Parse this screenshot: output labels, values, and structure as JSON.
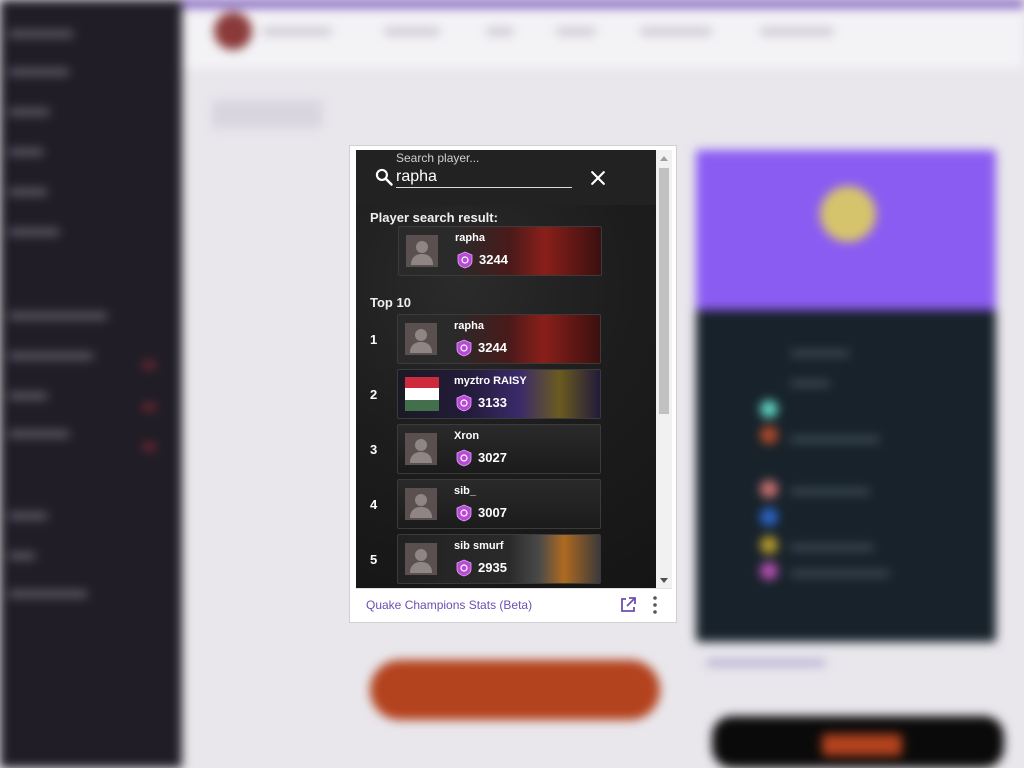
{
  "search": {
    "placeholder": "Search player...",
    "value": "rapha"
  },
  "result_section": {
    "title": "Player search result:",
    "players": [
      {
        "name": "rapha",
        "elo": "3244",
        "avatar": "default-avatar-icon",
        "banner": "red-champion"
      }
    ]
  },
  "top_section": {
    "title": "Top 10",
    "players": [
      {
        "rank": "1",
        "name": "rapha",
        "elo": "3244",
        "avatar": "default-avatar-icon",
        "banner": "red-champion"
      },
      {
        "rank": "2",
        "name": "myztro RAISY",
        "elo": "3133",
        "avatar": "hungary-flag-icon",
        "banner": "purple-creature"
      },
      {
        "rank": "3",
        "name": "Xron",
        "elo": "3027",
        "avatar": "default-avatar-icon",
        "banner": "plain"
      },
      {
        "rank": "4",
        "name": "sib_",
        "elo": "3007",
        "avatar": "default-avatar-icon",
        "banner": "plain"
      },
      {
        "rank": "5",
        "name": "sib smurf",
        "elo": "2935",
        "avatar": "default-avatar-icon",
        "banner": "orange-hex"
      }
    ]
  },
  "footer": {
    "title": "Quake Champions Stats (Beta)",
    "popout_icon": "popout-icon",
    "menu_icon": "more-vertical-icon"
  },
  "colors": {
    "accent": "#6c4fb2",
    "panel_bg": "#1d1d1d",
    "rank_badge": "#b84bd6"
  }
}
